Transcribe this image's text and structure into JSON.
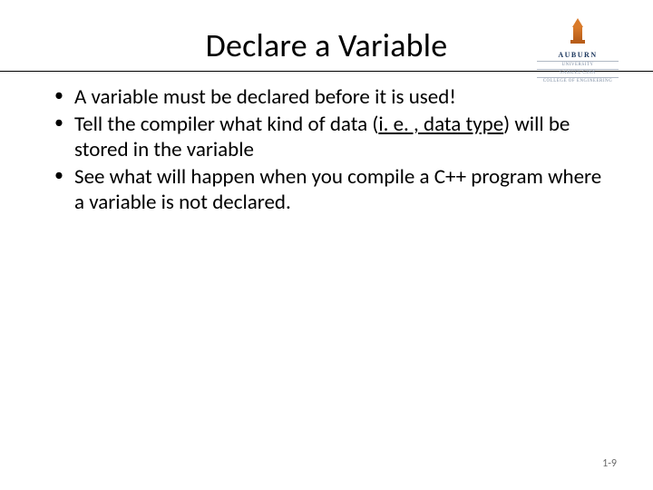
{
  "title": "Declare a Variable",
  "logo": {
    "name": "AUBURN",
    "subline_1": "UNIVERSITY",
    "subline_2": "SAMUEL GINN",
    "subline_3": "COLLEGE OF ENGINEERING"
  },
  "bullets": [
    {
      "pre": "A variable must be declared before it is used!",
      "underlined": "",
      "post": ""
    },
    {
      "pre": "Tell the compiler what kind of data (",
      "underlined": "i. e. , data type",
      "post": ") will be stored in the variable"
    },
    {
      "pre": "See what will happen when you compile a C++ program where a variable is not declared.",
      "underlined": "",
      "post": ""
    }
  ],
  "page_number": "1-9"
}
